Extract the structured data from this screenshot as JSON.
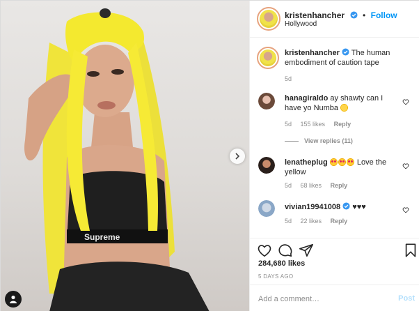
{
  "post": {
    "author": "kristenhancher",
    "follow_label": "Follow",
    "separator": "•",
    "location": "Hollywood",
    "caption": "The human embodiment of caution tape",
    "caption_age": "5d",
    "likes": "284,680 likes",
    "posted": "5 DAYS AGO"
  },
  "photo": {
    "carousel_next_icon": "chevron-right-icon",
    "user_tags_icon": "person-icon",
    "colors": {
      "hair": "#f2e72a",
      "top": "#1f1f1f",
      "skin": "#d9a68a",
      "background": "#e6e3e0"
    },
    "band_text": "Supreme"
  },
  "comments": [
    {
      "user": "hanagiraldo",
      "text": "ay shawty can I have yo Numba",
      "emoji": "smiling-face-emoji",
      "age": "5d",
      "likes": "155 likes",
      "reply": "Reply",
      "view_replies": "View replies (11)"
    },
    {
      "user": "lenatheplug",
      "text": "Love the yellow",
      "emoji": "heart-eyes-emoji",
      "age": "5d",
      "likes": "68 likes",
      "reply": "Reply"
    },
    {
      "user": "vivian19941008",
      "text": "♥♥♥",
      "age": "5d",
      "likes": "22 likes",
      "reply": "Reply"
    }
  ],
  "add_comment": {
    "placeholder": "Add a comment…",
    "post_label": "Post"
  },
  "theme": {
    "link_blue": "#0095f6",
    "verified_blue": "#3897f0",
    "muted": "#8e8e8e",
    "post_disabled": "#b2dffc"
  }
}
